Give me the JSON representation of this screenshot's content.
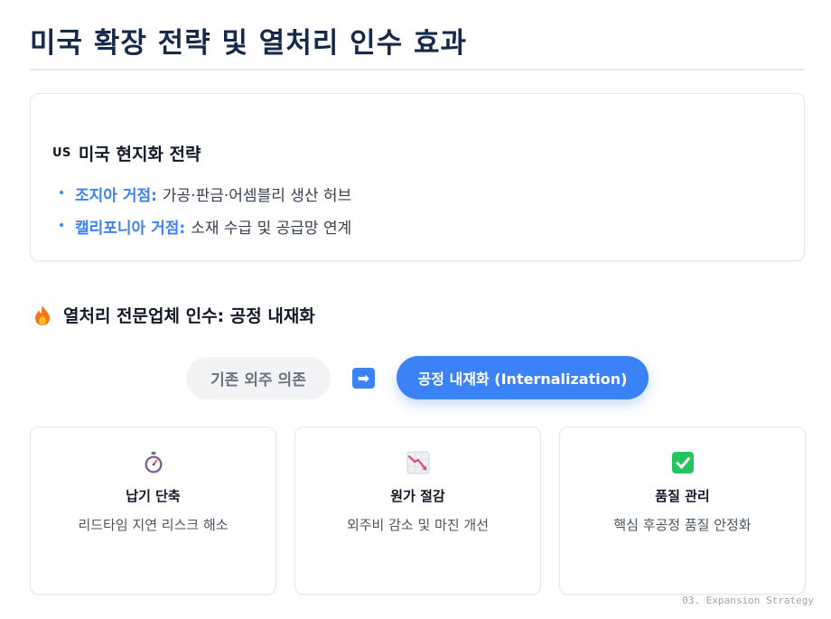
{
  "page": {
    "title": "미국 확장 전략 및 열처리 인수 효과"
  },
  "us_strategy": {
    "flag_label": "US",
    "heading": "미국 현지화 전략",
    "items": [
      {
        "key": "조지아 거점:",
        "text": "가공·판금·어셈블리 생산 허브"
      },
      {
        "key": "캘리포니아 거점:",
        "text": "소재 수급 및 공급망 연계"
      }
    ]
  },
  "acquisition": {
    "icon": "fire-icon",
    "heading": "열처리 전문업체 인수: 공정 내재화",
    "before_label": "기존 외주 의존",
    "arrow_icon": "right-arrow-icon",
    "after_label": "공정 내재화 (Internalization)"
  },
  "benefits": [
    {
      "icon": "stopwatch-icon",
      "title": "납기 단축",
      "desc": "리드타임 지연 리스크 해소"
    },
    {
      "icon": "chart-decreasing-icon",
      "title": "원가 절감",
      "desc": "외주비 감소 및 마진 개선"
    },
    {
      "icon": "check-mark-icon",
      "title": "품질 관리",
      "desc": "핵심 후공정 품질 안정화"
    }
  ],
  "footer": {
    "label": "03. Expansion Strategy"
  },
  "colors": {
    "accent": "#3b82f6",
    "title": "#15294a",
    "muted_pill_bg": "#f1f3f5",
    "check_green": "#22c55e",
    "fire_orange": "#f97316"
  }
}
